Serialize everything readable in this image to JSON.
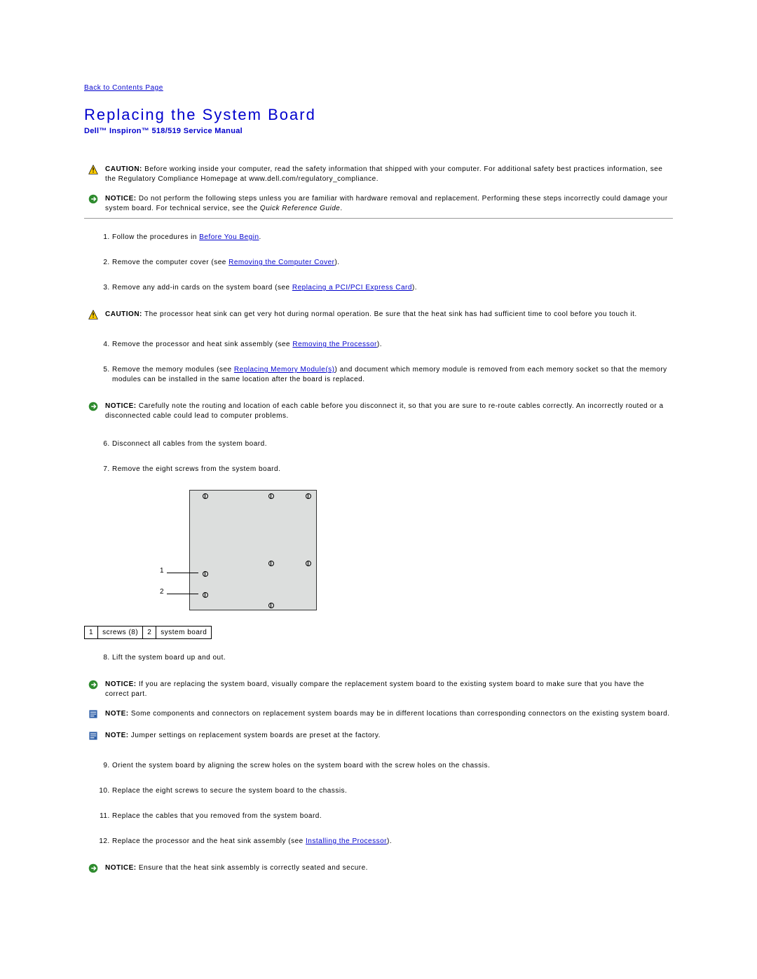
{
  "nav": {
    "back_link": "Back to Contents Page"
  },
  "title": "Replacing the System Board",
  "subtitle": "Dell™ Inspiron™ 518/519 Service Manual",
  "caution1": {
    "label": "CAUTION:",
    "text": "Before working inside your computer, read the safety information that shipped with your computer. For additional safety best practices information, see the Regulatory Compliance Homepage at www.dell.com/regulatory_compliance."
  },
  "notice1": {
    "label": "NOTICE:",
    "text_before": "Do not perform the following steps unless you are familiar with hardware removal and replacement. Performing these steps incorrectly could damage your system board. For technical service, see the ",
    "text_italic": "Quick Reference Guide",
    "text_after": "."
  },
  "steps1": {
    "s1_a": "Follow the procedures in ",
    "s1_link": "Before You Begin",
    "s1_b": ".",
    "s2_a": "Remove the computer cover (see ",
    "s2_link": "Removing the Computer Cover",
    "s2_b": ").",
    "s3_a": "Remove any add-in cards on the system board (see ",
    "s3_link": "Replacing a PCI/PCI Express Card",
    "s3_b": ")."
  },
  "caution2": {
    "label": "CAUTION:",
    "text": "The processor heat sink can get very hot during normal operation. Be sure that the heat sink has had sufficient time to cool before you touch it."
  },
  "steps2": {
    "s4_a": "Remove the processor and heat sink assembly (see ",
    "s4_link": "Removing the Processor",
    "s4_b": ").",
    "s5_a": "Remove the memory modules (see ",
    "s5_link": "Replacing Memory Module(s)",
    "s5_b": ") and document which memory module is removed from each memory socket so that the memory modules can be installed in the same location after the board is replaced."
  },
  "notice2": {
    "label": "NOTICE:",
    "text": "Carefully note the routing and location of each cable before you disconnect it, so that you are sure to re-route cables correctly. An incorrectly routed or a disconnected cable could lead to computer problems."
  },
  "steps3": {
    "s6": "Disconnect all cables from the system board.",
    "s7": "Remove the eight screws from the system board."
  },
  "diagram": {
    "callout1": "1",
    "callout2": "2"
  },
  "legend": {
    "n1": "1",
    "t1": "screws (8)",
    "n2": "2",
    "t2": "system board"
  },
  "steps4": {
    "s8": "Lift the system board up and out."
  },
  "notice3": {
    "label": "NOTICE:",
    "text": "If you are replacing the system board, visually compare the replacement system board to the existing system board to make sure that you have the correct part."
  },
  "note1": {
    "label": "NOTE:",
    "text": "Some components and connectors on replacement system boards may be in different locations than corresponding connectors on the existing system board."
  },
  "note2": {
    "label": "NOTE:",
    "text": "Jumper settings on replacement system boards are preset at the factory."
  },
  "steps5": {
    "s9": "Orient the system board by aligning the screw holes on the system board with the screw holes on the chassis.",
    "s10": "Replace the eight screws to secure the system board to the chassis.",
    "s11": "Replace the cables that you removed from the system board.",
    "s12_a": "Replace the processor and the heat sink assembly (see ",
    "s12_link": "Installing the Processor",
    "s12_b": ")."
  },
  "notice4": {
    "label": "NOTICE:",
    "text": "Ensure that the heat sink assembly is correctly seated and secure."
  }
}
